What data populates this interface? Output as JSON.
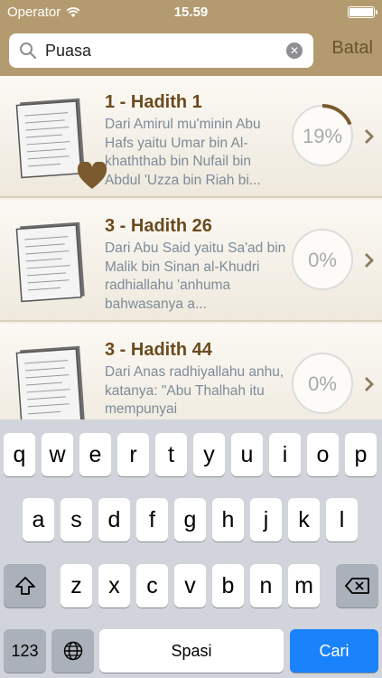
{
  "status": {
    "carrier": "Operator",
    "time": "15.59"
  },
  "search": {
    "value": "Puasa",
    "cancel_label": "Batal"
  },
  "results": [
    {
      "title": "1 - Hadith 1",
      "desc": "Dari Amirul mu'minin Abu Hafs yaitu Umar bin Al-khaththab bin Nufail bin Abdul 'Uzza bin Riah bi...",
      "progress_label": "19%",
      "progress": 0.19,
      "favorite": true
    },
    {
      "title": "3 - Hadith 26",
      "desc": "Dari Abu Said yaitu Sa'ad bin Malik bin Sinan al-Khudri radhiallahu 'anhuma bahwasanya a...",
      "progress_label": "0%",
      "progress": 0,
      "favorite": false
    },
    {
      "title": "3 - Hadith 44",
      "desc": "Dari Anas radhiyallahu anhu, katanya: \"Abu Thalhah itu mempunyai",
      "progress_label": "0%",
      "progress": 0,
      "favorite": false
    }
  ],
  "keyboard": {
    "row1": [
      "q",
      "w",
      "e",
      "r",
      "t",
      "y",
      "u",
      "i",
      "o",
      "p"
    ],
    "row2": [
      "a",
      "s",
      "d",
      "f",
      "g",
      "h",
      "j",
      "k",
      "l"
    ],
    "row3": [
      "z",
      "x",
      "c",
      "v",
      "b",
      "n",
      "m"
    ],
    "numbers_label": "123",
    "space_label": "Spasi",
    "return_label": "Cari"
  },
  "colors": {
    "header": "#b49b6f",
    "title": "#6b4a1e",
    "progress_arc": "#7a5a2e",
    "return_key": "#1a82fb"
  }
}
